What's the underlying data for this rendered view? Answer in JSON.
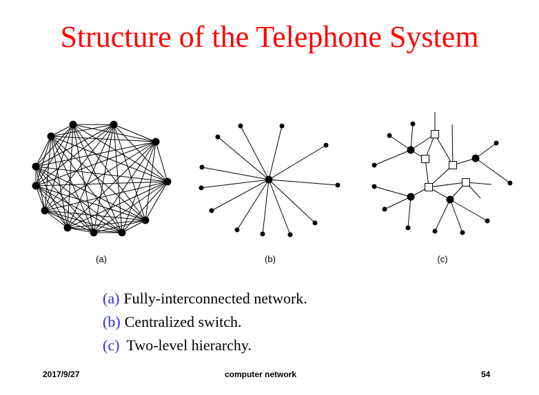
{
  "slide": {
    "title": "Structure of the Telephone System",
    "panel_labels": [
      "(a)",
      "(b)",
      "(c)"
    ],
    "captions": [
      {
        "key": "(a)",
        "text": "Fully-interconnected network."
      },
      {
        "key": "(b)",
        "text": "Centralized switch."
      },
      {
        "key": "(c)",
        "text": "Two-level hierarchy."
      }
    ],
    "footer": {
      "date": "2017/9/27",
      "course": "computer network",
      "page": "54"
    }
  }
}
